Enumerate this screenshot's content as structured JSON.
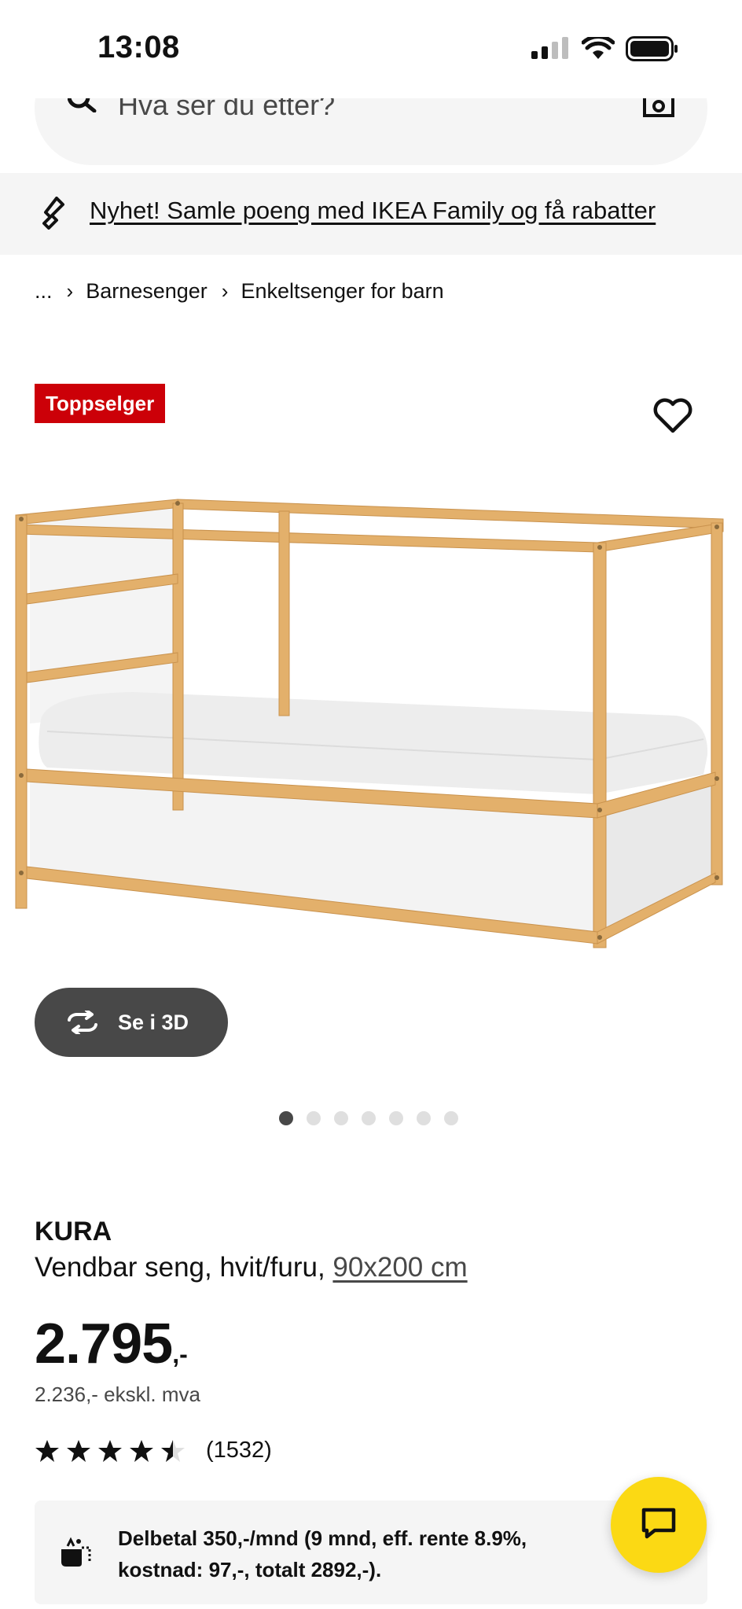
{
  "status_bar": {
    "time": "13:08",
    "icons": [
      "signal-icon",
      "wifi-icon",
      "battery-icon"
    ]
  },
  "search": {
    "placeholder": "Hva ser du etter?",
    "icons": [
      "search-icon",
      "camera-icon"
    ]
  },
  "promo": {
    "text": "Nyhet! Samle poeng med IKEA Family og få rabatter",
    "icon": "ikea-family-link-icon"
  },
  "breadcrumb": {
    "items": [
      "...",
      "Barnesenger",
      "Enkeltsenger for barn"
    ]
  },
  "product": {
    "badge": "Toppselger",
    "name": "KURA",
    "description": "Vendbar seng, hvit/furu,",
    "size": "90x200 cm",
    "price_integer": "2.795",
    "price_decimal": ",-",
    "price_ex_vat": "2.236,- ekskl. mva",
    "rating": 4.5,
    "rating_max": 5,
    "review_count": "(1532)",
    "image_count": 7,
    "active_image": 1
  },
  "view3d": {
    "label": "Se i 3D"
  },
  "installment": {
    "text": "Delbetal 350,-/mnd (9 mnd, eff. rente 8.9%, kostnad: 97,-, totalt 2892,-)."
  },
  "colors": {
    "badge": "#cc0008",
    "fab": "#fbd914",
    "dark_button": "#484848",
    "panel": "#f5f5f5",
    "wood": "#e3b06b"
  }
}
